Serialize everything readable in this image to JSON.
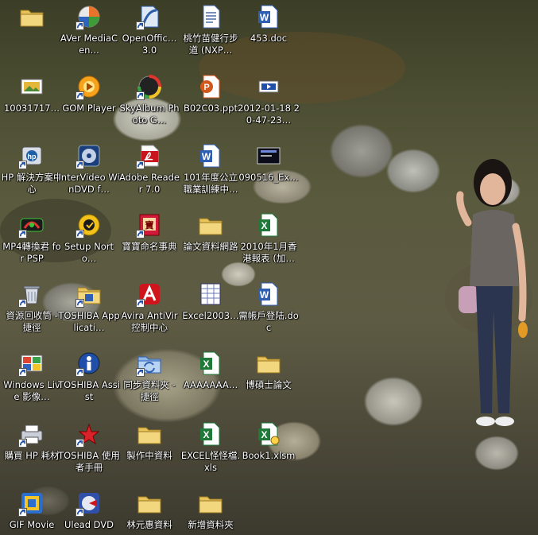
{
  "desktop": {
    "icons": [
      {
        "label": "",
        "icon": "folder-icon",
        "shortcut": false
      },
      {
        "label": "AVer MediaCen…",
        "icon": "aver-media-icon",
        "shortcut": true
      },
      {
        "label": "OpenOffic… 3.0",
        "icon": "openoffice-icon",
        "shortcut": true
      },
      {
        "label": "桃竹苗健行步道 (NXP…",
        "icon": "document-icon",
        "shortcut": false
      },
      {
        "label": "453.doc",
        "icon": "word-document-icon",
        "shortcut": false
      },
      {
        "label": "10031717…",
        "icon": "image-file-icon",
        "shortcut": false
      },
      {
        "label": "GOM Player",
        "icon": "gom-player-icon",
        "shortcut": true
      },
      {
        "label": "SkyAlbum Photo G…",
        "icon": "skyalbum-icon",
        "shortcut": true
      },
      {
        "label": "B02C03.ppt",
        "icon": "powerpoint-icon",
        "shortcut": false
      },
      {
        "label": "2012-01-18 20-47-23…",
        "icon": "video-file-icon",
        "shortcut": false
      },
      {
        "label": "HP 解決方案中心",
        "icon": "hp-solution-icon",
        "shortcut": true
      },
      {
        "label": "InterVideo WinDVD f…",
        "icon": "windvd-icon",
        "shortcut": true
      },
      {
        "label": "Adobe Reader 7.0",
        "icon": "adobe-reader-icon",
        "shortcut": true
      },
      {
        "label": "101年度公立職業訓練中…",
        "icon": "word-document-icon",
        "shortcut": false
      },
      {
        "label": "090516_Ex…",
        "icon": "thumbnail-icon",
        "shortcut": false
      },
      {
        "label": "MP4轉換君 for PSP",
        "icon": "mp4-converter-icon",
        "shortcut": true
      },
      {
        "label": "Setup Norto…",
        "icon": "norton-setup-icon",
        "shortcut": true
      },
      {
        "label": "寶寶命名事典",
        "icon": "baby-name-icon",
        "shortcut": true
      },
      {
        "label": "論文資料網路",
        "icon": "folder-icon",
        "shortcut": false
      },
      {
        "label": "2010年1月香港報表 (加…",
        "icon": "excel-icon",
        "shortcut": false
      },
      {
        "label": "資源回收筒 - 捷徑",
        "icon": "recycle-bin-icon",
        "shortcut": true
      },
      {
        "label": "TOSHIBA Applicati…",
        "icon": "toshiba-folder-icon",
        "shortcut": true
      },
      {
        "label": "Avira AntiVir 控制中心",
        "icon": "avira-icon",
        "shortcut": true
      },
      {
        "label": "Excel2003…",
        "icon": "excel-sheet-icon",
        "shortcut": false
      },
      {
        "label": "需帳戶登陆.doc",
        "icon": "word-document-icon",
        "shortcut": false
      },
      {
        "label": "Windows Live 影像…",
        "icon": "windows-live-icon",
        "shortcut": true
      },
      {
        "label": "TOSHIBA Assist",
        "icon": "toshiba-assist-icon",
        "shortcut": true
      },
      {
        "label": "同步資料夾 - 捷徑",
        "icon": "sync-folder-icon",
        "shortcut": true
      },
      {
        "label": "AAAAAAA…",
        "icon": "excel-icon",
        "shortcut": false
      },
      {
        "label": "博碩士論文",
        "icon": "folder-icon",
        "shortcut": false
      },
      {
        "label": "購買 HP 耗材",
        "icon": "hp-printer-icon",
        "shortcut": true
      },
      {
        "label": "TOSHIBA 使用者手冊",
        "icon": "toshiba-manual-icon",
        "shortcut": true
      },
      {
        "label": "製作中資料",
        "icon": "folder-icon",
        "shortcut": false
      },
      {
        "label": "EXCEL怪怪檔.xls",
        "icon": "excel-icon",
        "shortcut": false
      },
      {
        "label": "Book1.xlsm",
        "icon": "excel-macro-icon",
        "shortcut": false
      },
      {
        "label": "GIF Movie",
        "icon": "gif-movie-icon",
        "shortcut": true
      },
      {
        "label": "Ulead DVD",
        "icon": "ulead-dvd-icon",
        "shortcut": true
      },
      {
        "label": "林元惠資料",
        "icon": "folder-icon",
        "shortcut": false
      },
      {
        "label": "新增資料夾",
        "icon": "folder-icon",
        "shortcut": false
      }
    ]
  },
  "colors": {
    "folder": "#e8c35a",
    "word": "#2f5fb3",
    "excel": "#1f7a3a",
    "powerpoint": "#d2571b",
    "adobe": "#c8141c",
    "label_text": "#ffffff"
  }
}
